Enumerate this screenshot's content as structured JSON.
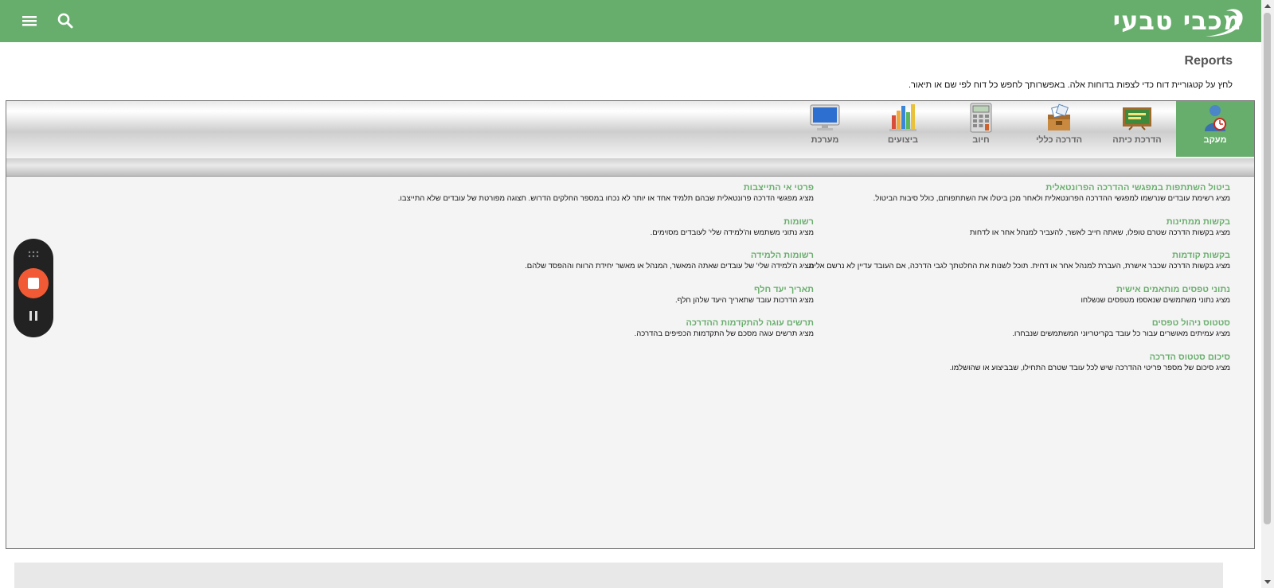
{
  "header": {
    "logo_text": "מכבי טבעי",
    "menu_icon": "hamburger-menu-icon",
    "search_icon": "search-icon",
    "bar_color": "#67ae6c"
  },
  "page": {
    "title": "Reports",
    "intro": "לחץ על קטגוריית דוח כדי לצפות בדוחות אלה. באפשרותך לחפש כל דוח לפי שם או תיאור."
  },
  "tabs": [
    {
      "label": "מעקב",
      "icon": "user-tracking-icon",
      "active": true
    },
    {
      "label": "הדרכת כיתה",
      "icon": "classroom-board-icon",
      "active": false
    },
    {
      "label": "הדרכה כללי",
      "icon": "general-training-box-icon",
      "active": false
    },
    {
      "label": "חיוב",
      "icon": "calculator-icon",
      "active": false
    },
    {
      "label": "ביצועים",
      "icon": "bar-chart-icon",
      "active": false
    },
    {
      "label": "מערכת",
      "icon": "monitor-icon",
      "active": false
    }
  ],
  "reports_right": [
    {
      "title": "ביטול השתתפות במפגשי ההדרכה הפרונטאלית",
      "desc": "מציג רשימת עובדים שנרשמו למפגשי ההדרכה הפרונטאלית ולאחר מכן ביטלו את השתתפותם, כולל סיבות הביטול."
    },
    {
      "title": "בקשות ממתינות",
      "desc": "מציג בקשות הדרכה שטרם טופלו, שאתה חייב לאשר, להעביר למנהל אחר או לדחות"
    },
    {
      "title": "בקשות קודמות",
      "desc": "מציג בקשות הדרכה שכבר אישרת, העברת למנהל אחר או דחית. תוכל לשנות את החלטתך לגבי הדרכה, אם העובד עדיין לא נרשם אליה."
    },
    {
      "title": "נתוני טפסים מותאמים אישית",
      "desc": "מציג נתוני משתמשים שנאספו מטפסים שנשלחו"
    },
    {
      "title": "סטטוס ניהול טפסים",
      "desc": "מציג עמיתים מאושרים עבור כל עובד בקריטריוני המשתמשים שנבחרו."
    },
    {
      "title": "סיכום סטטוס הדרכה",
      "desc": "מציג סיכום של מספר פריטי ההדרכה שיש לכל עובד שטרם התחילו, שבביצוע או שהושלמו."
    }
  ],
  "reports_left": [
    {
      "title": "פרטי אי התייצבות",
      "desc": "מציג מפגשי הדרכה פרונטאלית שבהם תלמיד אחד או יותר לא נכחו במספר החלקים הדרוש. תצוגה מפורטת של עובדים שלא התייצבו."
    },
    {
      "title": "רשומות",
      "desc": "מציג נתוני משתמש וה'למידה שלי' לעובדים מסוימים."
    },
    {
      "title": "רשומות הלמידה",
      "desc": "מציג ה'למידה שלי' של עובדים שאתה המאשר, המנהל או מאשר יחידת הרווח וההפסד שלהם."
    },
    {
      "title": "תאריך יעד חלף",
      "desc": "מציג הדרכות עובד שתאריך היעד שלהן חלף."
    },
    {
      "title": "תרשים עוגה להתקדמות ההדרכה",
      "desc": "מציג תרשים עוגה מסכם של התקדמות הכפיפים בהדרכה."
    }
  ],
  "recorder": {
    "drag_icon": "drag-handle-icon",
    "stop_icon": "stop-record-icon",
    "pause_icon": "pause-icon",
    "stop_color": "#f15a35"
  }
}
